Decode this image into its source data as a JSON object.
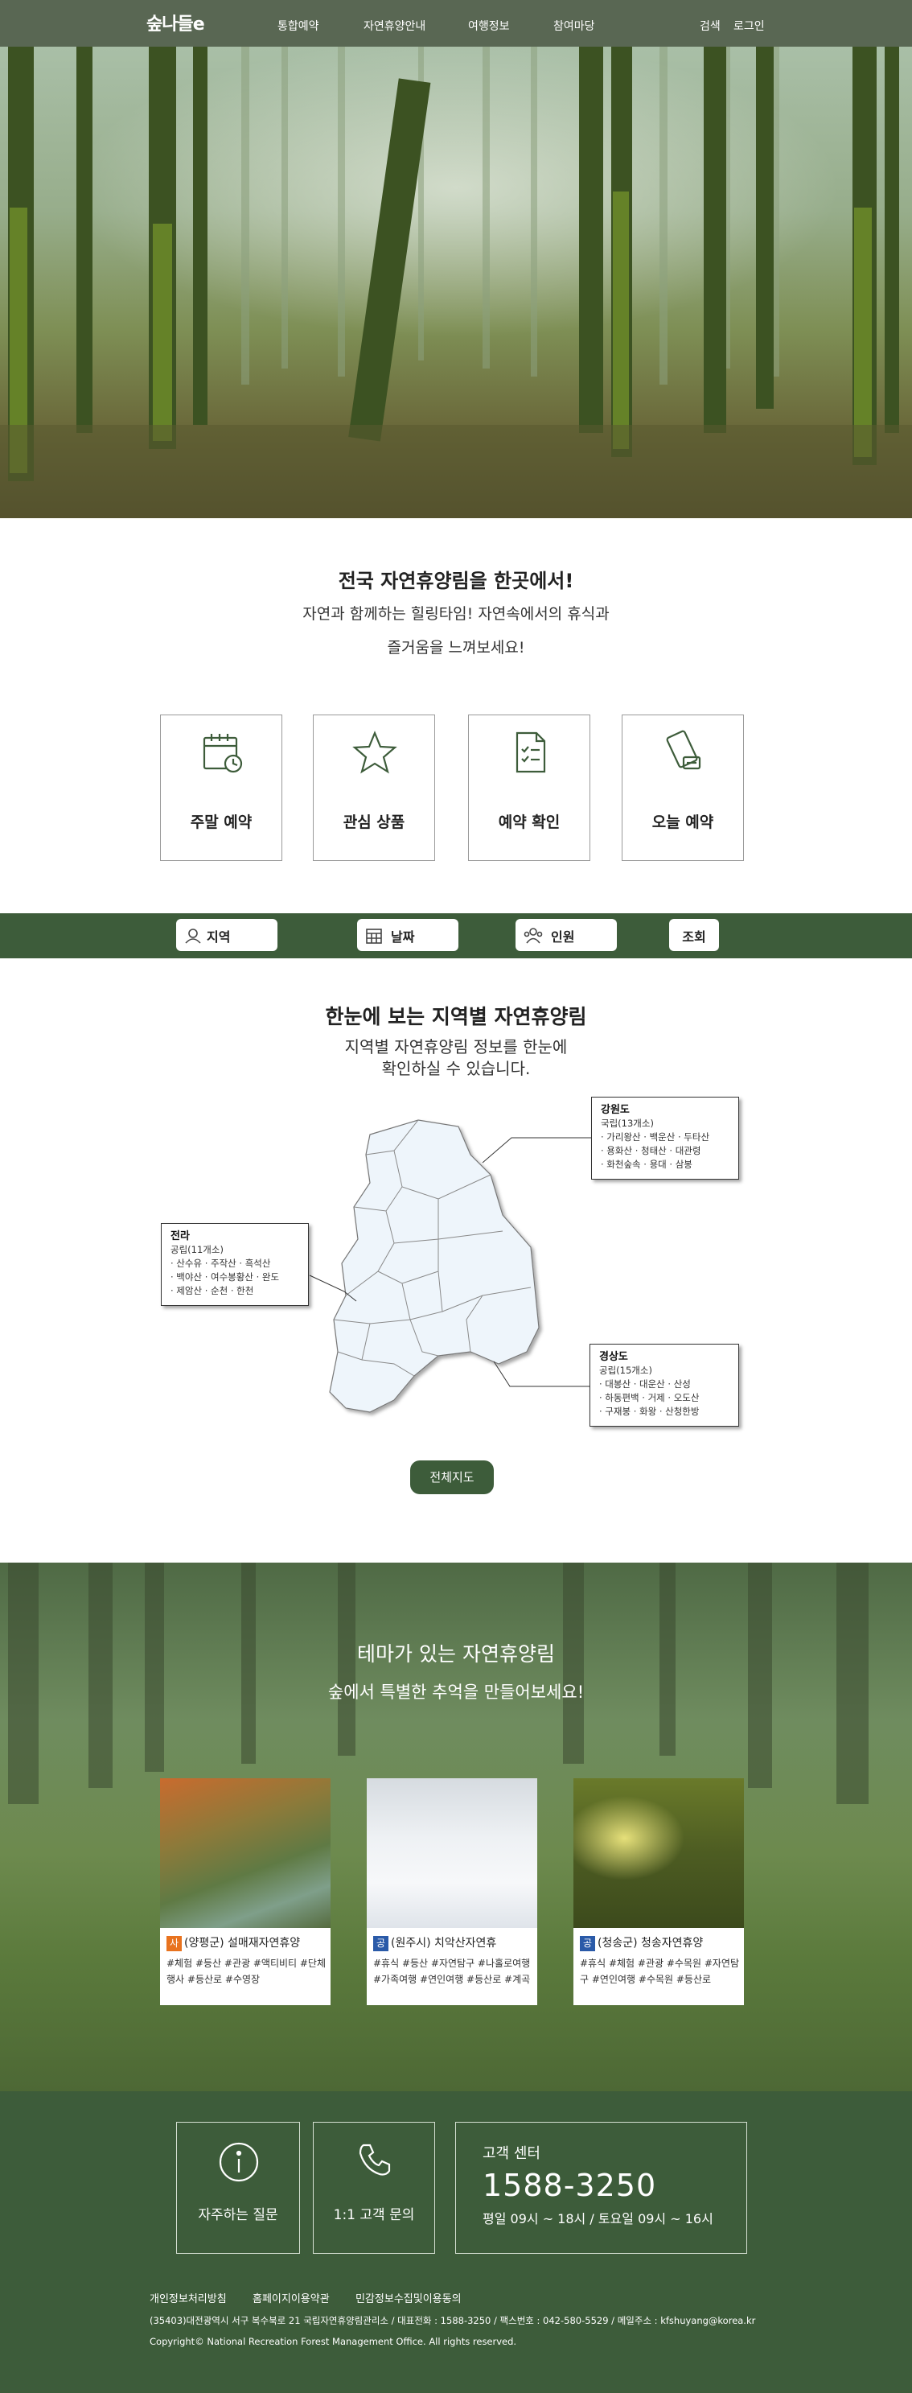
{
  "header": {
    "logo_text": "숲나들e",
    "nav": [
      "통합예약",
      "자연휴양안내",
      "여행정보",
      "참여마당"
    ],
    "util": [
      "검색",
      "로그인"
    ]
  },
  "intro": {
    "title": "전국 자연휴양림을 한곳에서!",
    "sub1": "자연과 함께하는 힐링타임! 자연속에서의 휴식과",
    "sub2": "즐거움을 느껴보세요!"
  },
  "quick_menu": [
    {
      "label": "주말 예약",
      "icon": "calendar-icon"
    },
    {
      "label": "관심 상품",
      "icon": "star-icon"
    },
    {
      "label": "예약 확인",
      "icon": "document-icon"
    },
    {
      "label": "오늘 예약",
      "icon": "phone-tag-icon"
    }
  ],
  "search_bar": {
    "region": "지역",
    "date": "날짜",
    "people": "인원",
    "submit": "조회"
  },
  "map": {
    "title": "한눈에 보는 지역별 자연휴양림",
    "sub1": "지역별 자연휴양림 정보를 한눈에",
    "sub2": "확인하실 수 있습니다.",
    "button": "전체지도",
    "regions": {
      "gangwon": {
        "name": "강원도",
        "count": "국립(13개소)",
        "lines": [
          "· 가리왕산 · 백운산 · 두타산",
          "· 용화산 · 청태산 · 대관령",
          "· 화천숲속 · 용대 · 삼봉"
        ]
      },
      "jeolla": {
        "name": "전라",
        "count": "공립(11개소)",
        "lines": [
          "· 산수유 · 주작산 · 흑석산",
          "· 백야산 · 여수봉황산 · 완도",
          "· 제암산 · 순천 · 한천"
        ]
      },
      "gyeongsang": {
        "name": "경상도",
        "count": "공립(15개소)",
        "lines": [
          "· 대봉산 · 대운산 · 산성",
          "· 하동편백 · 거제 · 오도산",
          "· 구재봉 · 화왕 · 산청한방"
        ]
      }
    }
  },
  "theme": {
    "title": "테마가 있는 자연휴양림",
    "sub": "숲에서 특별한 추억을 만들어보세요!",
    "cards": [
      {
        "badge": "사",
        "badge_color": "#e8731f",
        "name": "(양평군) 설매재자연휴양",
        "tags": "#체험 #등산 #관광 #액티비티 #단체행사 #등산로 #수영장"
      },
      {
        "badge": "공",
        "badge_color": "#2a5aa8",
        "name": "(원주시) 치악산자연휴",
        "tags": "#휴식 #등산 #자연탐구 #나홀로여행 #가족여행 #연인여행 #등산로 #계곡"
      },
      {
        "badge": "공",
        "badge_color": "#2a5aa8",
        "name": "(청송군) 청송자연휴양",
        "tags": "#휴식 #체험 #관광 #수목원 #자연탐구 #연인여행 #수목원 #등산로"
      }
    ]
  },
  "footer": {
    "faq": "자주하는 질문",
    "inquiry": "1:1 고객 문의",
    "cs_title": "고객 센터",
    "cs_phone": "1588-3250",
    "cs_hours": "평일 09시 ~ 18시 / 토요일 09시 ~ 16시",
    "links": [
      "개인정보처리방침",
      "홈페이지이용약관",
      "민감정보수집및이용동의"
    ],
    "address": "(35403)대전광역시 서구 복수북로 21 국립자연휴양림관리소 / 대표전화 : 1588-3250 / 팩스번호 : 042-580-5529 / 메일주소 : kfshuyang@korea.kr",
    "copyright": "Copyright© National Recreation Forest Management Office. All rights reserved."
  }
}
